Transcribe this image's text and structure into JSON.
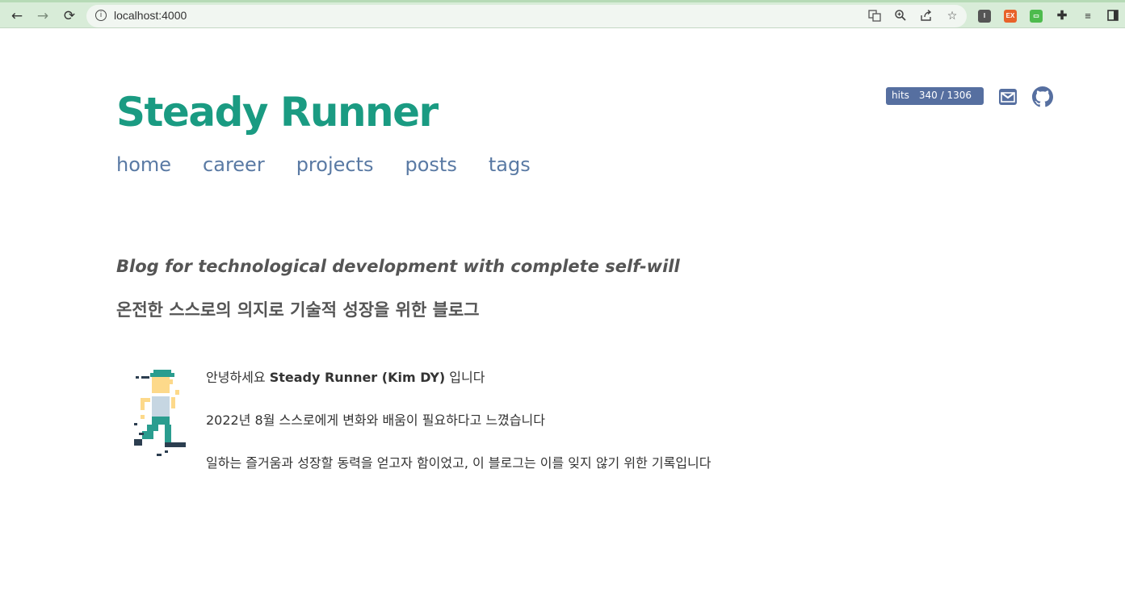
{
  "browser": {
    "url": "localhost:4000"
  },
  "site": {
    "title": "Steady Runner",
    "nav": [
      "home",
      "career",
      "projects",
      "posts",
      "tags"
    ],
    "hits_label": "hits",
    "hits_count": "340 / 1306",
    "accent_color": "#1a9b82",
    "link_color": "#5a7aa4"
  },
  "hero": {
    "tagline_en": "Blog for technological development with complete self-will",
    "tagline_ko": "온전한 스스로의 의지로 기술적 성장을 위한 블로그"
  },
  "intro": {
    "line1_prefix": "안녕하세요 ",
    "line1_bold": "Steady Runner (Kim DY)",
    "line1_suffix": " 입니다",
    "line2": "2022년 8월 스스로에게 변화와 배움이 필요하다고 느꼈습니다",
    "line3": "일하는 즐거움과 성장할 동력을 얻고자 함이었고, 이 블로그는 이를 잊지 않기 위한 기록입니다"
  }
}
